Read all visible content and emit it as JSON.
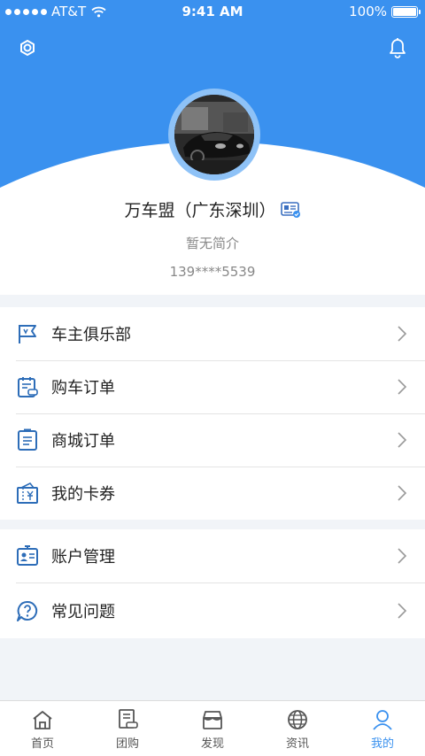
{
  "status_bar": {
    "carrier": "AT&T",
    "time": "9:41 AM",
    "battery": "100%"
  },
  "profile": {
    "name": "万车盟（广东深圳）",
    "bio": "暂无简介",
    "phone": "139****5539"
  },
  "menu_groups": [
    {
      "items": [
        {
          "label": "车主俱乐部",
          "icon": "flag-icon"
        },
        {
          "label": "购车订单",
          "icon": "car-order-icon"
        },
        {
          "label": "商城订单",
          "icon": "clipboard-icon"
        },
        {
          "label": "我的卡券",
          "icon": "coupon-icon"
        }
      ]
    },
    {
      "items": [
        {
          "label": "账户管理",
          "icon": "id-card-icon"
        },
        {
          "label": "常见问题",
          "icon": "question-bubble-icon"
        }
      ]
    }
  ],
  "tabs": [
    {
      "label": "首页",
      "icon": "home-icon",
      "active": false
    },
    {
      "label": "团购",
      "icon": "group-buy-icon",
      "active": false
    },
    {
      "label": "发现",
      "icon": "discover-icon",
      "active": false
    },
    {
      "label": "资讯",
      "icon": "globe-icon",
      "active": false
    },
    {
      "label": "我的",
      "icon": "person-icon",
      "active": true
    }
  ],
  "colors": {
    "primary": "#3a91ef",
    "icon": "#2d6db8",
    "background": "#f1f4f8"
  }
}
